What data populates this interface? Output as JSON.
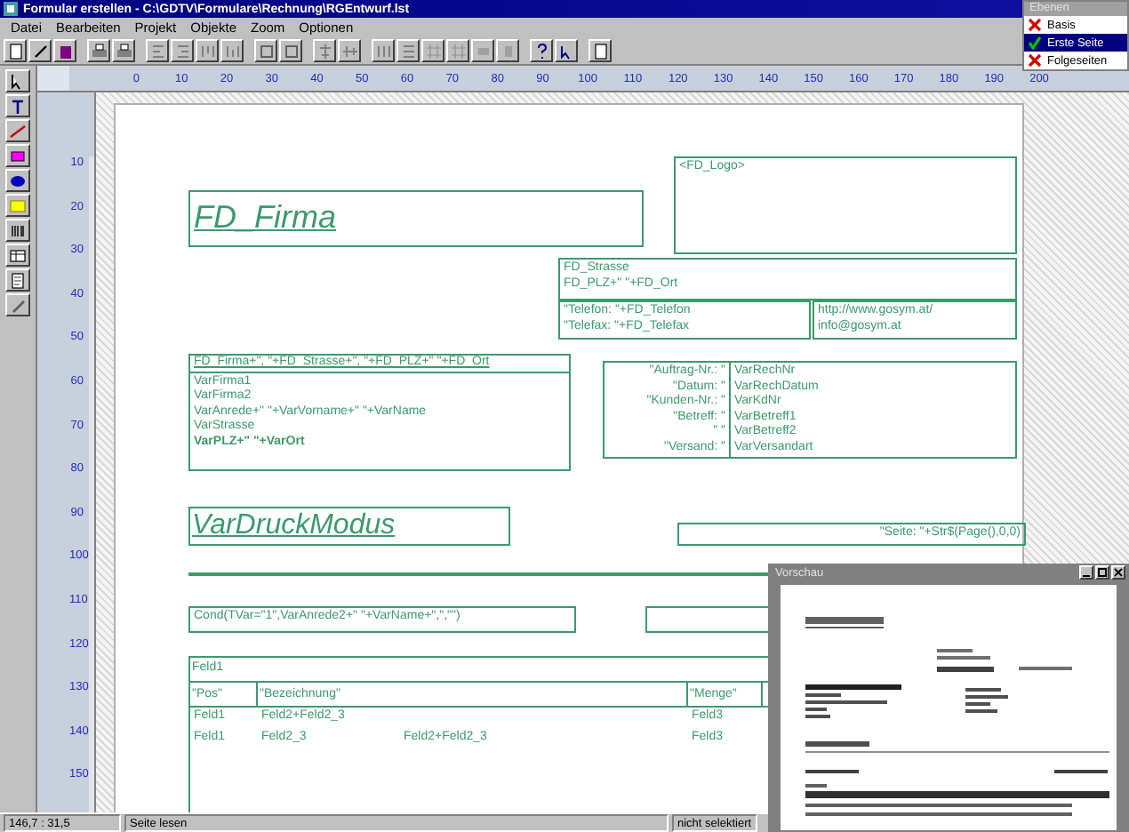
{
  "window": {
    "title": "Formular erstellen - C:\\GDTV\\Formulare\\Rechnung\\RGEntwurf.lst"
  },
  "menu": [
    "Datei",
    "Bearbeiten",
    "Projekt",
    "Objekte",
    "Zoom",
    "Optionen"
  ],
  "ruler": {
    "horizontal": [
      "0",
      "10",
      "20",
      "30",
      "40",
      "50",
      "60",
      "70",
      "80",
      "90",
      "100",
      "110",
      "120",
      "130",
      "140",
      "150",
      "160",
      "170",
      "180",
      "190",
      "200"
    ],
    "vertical": [
      "10",
      "20",
      "30",
      "40",
      "50",
      "60",
      "70",
      "80",
      "90",
      "100",
      "110",
      "120",
      "130",
      "140",
      "150"
    ]
  },
  "layers": {
    "title": "Ebenen",
    "items": [
      {
        "label": "Basis",
        "visible": false,
        "selected": false
      },
      {
        "label": "Erste Seite",
        "visible": true,
        "selected": true
      },
      {
        "label": "Folgeseiten",
        "visible": false,
        "selected": false
      }
    ]
  },
  "design": {
    "objects": [
      {
        "kind": "heading",
        "text": "FD_Firma"
      },
      {
        "kind": "lines",
        "lines": [
          "<FD_Logo>"
        ]
      },
      {
        "kind": "lines",
        "lines": [
          "FD_Strasse",
          "FD_PLZ+\" \"+FD_Ort"
        ]
      },
      {
        "kind": "lines",
        "lines": [
          "\"Telefon: \"+FD_Telefon",
          "\"Telefax: \"+FD_Telefax"
        ]
      },
      {
        "kind": "lines",
        "lines": [
          "http://www.gosym.at/",
          "info@gosym.at"
        ]
      },
      {
        "kind": "address",
        "header": "FD_Firma+\", \"+FD_Strasse+\", \"+FD_PLZ+\" \"+FD_Ort",
        "lines": [
          {
            "text": "VarFirma1",
            "bold": false
          },
          {
            "text": "VarFirma2",
            "bold": false
          },
          {
            "text": "VarAnrede+\" \"+VarVorname+\" \"+VarName",
            "bold": false
          },
          {
            "text": "VarStrasse",
            "bold": false
          },
          {
            "text": "VarPLZ+\" \"+VarOrt",
            "bold": true
          }
        ]
      },
      {
        "kind": "fields",
        "rows": [
          {
            "label": "\"Auftrag-Nr.: \"",
            "value": "VarRechNr"
          },
          {
            "label": "\"Datum: \"",
            "value": "VarRechDatum"
          },
          {
            "label": "\"Kunden-Nr.: \"",
            "value": "VarKdNr"
          },
          {
            "label": "\"Betreff: \"",
            "value": "VarBetreff1"
          },
          {
            "label": "\" \"",
            "value": "VarBetreff2"
          },
          {
            "label": "\"Versand: \"",
            "value": "VarVersandart"
          }
        ]
      },
      {
        "kind": "heading",
        "text": "VarDruckModus"
      },
      {
        "kind": "right",
        "text": "\"Seite: \"+Str$(Page(),0,0)"
      },
      {
        "kind": "rule"
      },
      {
        "kind": "lines",
        "lines": [
          "Cond(TVar=\"1\",VarAnrede2+\" \"+VarName+\",\",\"\")"
        ]
      },
      {
        "kind": "lines"
      },
      {
        "kind": "table",
        "title": "Feld1",
        "columns": [
          "\"Pos\"",
          "\"Bezeichnung\"",
          "",
          "\"Menge\""
        ],
        "rows": [
          [
            "Feld1",
            "Feld2+Feld2_3",
            "",
            "Feld3"
          ],
          [
            "Feld1",
            "Feld2_3",
            "Feld2+Feld2_3",
            "Feld3"
          ]
        ]
      }
    ]
  },
  "preview": {
    "title": "Vorschau"
  },
  "status_bar": [
    "146,7 : 31,5",
    "Seite lesen",
    "nicht selektiert"
  ]
}
